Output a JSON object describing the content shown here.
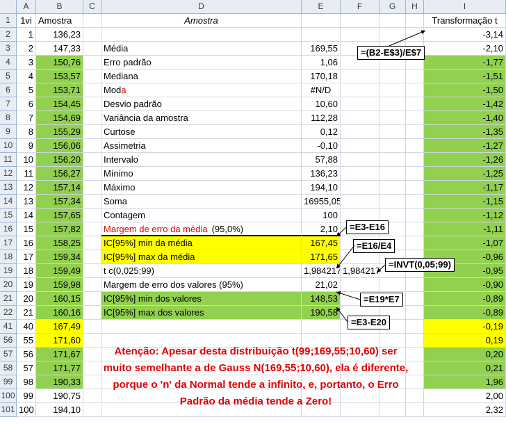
{
  "columns": [
    "A",
    "B",
    "C",
    "D",
    "E",
    "F",
    "G",
    "H",
    "I"
  ],
  "rows": [
    {
      "r": "1",
      "a": "1vi",
      "b": "Amostra",
      "d": "Amostra",
      "e": "",
      "f": "",
      "i": "Transformação t",
      "bFill": "",
      "iFill": ""
    },
    {
      "r": "2",
      "a": "1",
      "b": "136,23",
      "d": "",
      "e": "",
      "f": "",
      "i": "-3,14",
      "bFill": "",
      "iFill": ""
    },
    {
      "r": "3",
      "a": "2",
      "b": "147,33",
      "d": "Média",
      "e": "169,55",
      "f": "",
      "i": "-2,10",
      "bFill": "",
      "iFill": ""
    },
    {
      "r": "4",
      "a": "3",
      "b": "150,76",
      "d": "Erro padrão",
      "e": "1,06",
      "f": "",
      "i": "-1,77",
      "bFill": "green",
      "iFill": "green"
    },
    {
      "r": "5",
      "a": "4",
      "b": "153,57",
      "d": "Mediana",
      "e": "170,18",
      "f": "",
      "i": "-1,51",
      "bFill": "green",
      "iFill": "green"
    },
    {
      "r": "6",
      "a": "5",
      "b": "153,71",
      "d": "Moda",
      "e": "#N/D",
      "f": "",
      "i": "-1,50",
      "bFill": "green",
      "iFill": "green"
    },
    {
      "r": "7",
      "a": "6",
      "b": "154,45",
      "d": "Desvio padrão",
      "e": "10,60",
      "f": "",
      "i": "-1,42",
      "bFill": "green",
      "iFill": "green"
    },
    {
      "r": "8",
      "a": "7",
      "b": "154,69",
      "d": "Variância da amostra",
      "e": "112,28",
      "f": "",
      "i": "-1,40",
      "bFill": "green",
      "iFill": "green"
    },
    {
      "r": "9",
      "a": "8",
      "b": "155,29",
      "d": "Curtose",
      "e": "0,12",
      "f": "",
      "i": "-1,35",
      "bFill": "green",
      "iFill": "green"
    },
    {
      "r": "10",
      "a": "9",
      "b": "156,06",
      "d": "Assimetria",
      "e": "-0,10",
      "f": "",
      "i": "-1,27",
      "bFill": "green",
      "iFill": "green"
    },
    {
      "r": "11",
      "a": "10",
      "b": "156,20",
      "d": "Intervalo",
      "e": "57,88",
      "f": "",
      "i": "-1,26",
      "bFill": "green",
      "iFill": "green"
    },
    {
      "r": "12",
      "a": "11",
      "b": "156,27",
      "d": "Mínimo",
      "e": "136,23",
      "f": "",
      "i": "-1,25",
      "bFill": "green",
      "iFill": "green"
    },
    {
      "r": "13",
      "a": "12",
      "b": "157,14",
      "d": "Máximo",
      "e": "194,10",
      "f": "",
      "i": "-1,17",
      "bFill": "green",
      "iFill": "green"
    },
    {
      "r": "14",
      "a": "13",
      "b": "157,34",
      "d": "Soma",
      "e": "16955,05",
      "f": "",
      "i": "-1,15",
      "bFill": "green",
      "iFill": "green"
    },
    {
      "r": "15",
      "a": "14",
      "b": "157,65",
      "d": "Contagem",
      "e": "100",
      "f": "",
      "i": "-1,12",
      "bFill": "green",
      "iFill": "green"
    },
    {
      "r": "16",
      "a": "15",
      "b": "157,82",
      "d": "Margem de erro da média",
      "d2": "(95,0%)",
      "e": "2,10",
      "f": "",
      "i": "-1,11",
      "bFill": "green",
      "iFill": "green"
    },
    {
      "r": "17",
      "a": "16",
      "b": "158,25",
      "d": "IC[95%] min da média",
      "e": "167,45",
      "f": "",
      "i": "-1,07",
      "bFill": "green",
      "iFill": "green",
      "deFill": "yellow"
    },
    {
      "r": "18",
      "a": "17",
      "b": "159,34",
      "d": "IC[95%] max da média",
      "e": "171,65",
      "f": "",
      "i": "-0,96",
      "bFill": "green",
      "iFill": "green",
      "deFill": "yellow"
    },
    {
      "r": "19",
      "a": "18",
      "b": "159,49",
      "d": "t c(0,025;99)",
      "e": "1,984217",
      "f": "1,984217",
      "i": "-0,95",
      "bFill": "green",
      "iFill": "green"
    },
    {
      "r": "20",
      "a": "19",
      "b": "159,98",
      "d": "Margem de erro dos valores (95%)",
      "e": "21,02",
      "f": "",
      "i": "-0,90",
      "bFill": "green",
      "iFill": "green"
    },
    {
      "r": "21",
      "a": "20",
      "b": "160,15",
      "d": "IC[95%] min dos valores",
      "e": "148,53",
      "f": "",
      "i": "-0,89",
      "bFill": "green",
      "iFill": "green",
      "deFill": "green"
    },
    {
      "r": "22",
      "a": "21",
      "b": "160,16",
      "d": "IC[95%] max dos valores",
      "e": "190,58",
      "f": "",
      "i": "-0,89",
      "bFill": "green",
      "iFill": "green",
      "deFill": "green"
    },
    {
      "r": "41",
      "a": "40",
      "b": "167,49",
      "d": "",
      "e": "",
      "f": "",
      "i": "-0,19",
      "bFill": "yellow",
      "iFill": "yellow"
    },
    {
      "r": "56",
      "a": "55",
      "b": "171,60",
      "d": "",
      "e": "",
      "f": "",
      "i": "0,19",
      "bFill": "yellow",
      "iFill": "yellow"
    },
    {
      "r": "57",
      "a": "56",
      "b": "171,67",
      "d": "",
      "e": "",
      "f": "",
      "i": "0,20",
      "bFill": "green",
      "iFill": "green"
    },
    {
      "r": "58",
      "a": "57",
      "b": "171,77",
      "d": "",
      "e": "",
      "f": "",
      "i": "0,21",
      "bFill": "green",
      "iFill": "green"
    },
    {
      "r": "99",
      "a": "98",
      "b": "190,33",
      "d": "",
      "e": "",
      "f": "",
      "i": "1,96",
      "bFill": "green",
      "iFill": "green"
    },
    {
      "r": "100",
      "a": "99",
      "b": "190,75",
      "d": "",
      "e": "",
      "f": "",
      "i": "2,00",
      "bFill": "",
      "": "",
      "iFill": ""
    },
    {
      "r": "101",
      "a": "100",
      "b": "194,10",
      "d": "",
      "e": "",
      "f": "",
      "i": "2,32",
      "bFill": "",
      "iFill": ""
    }
  ],
  "callouts": {
    "transform": "=(B2-E$3)/E$7",
    "margin": "=E3-E16",
    "ic_max": "=E16/E4",
    "invt": "=INVT(0,05;99)",
    "margin_values": "=E19*E7",
    "ic_min_values": "=E3-E20"
  },
  "note": "Atenção: Apesar desta distribuição t(99;169,55;10,60) ser muito semelhante a de Gauss N(169,55;10,60), ela é diferente, porque o 'n' da Normal tende a infinito, e, portanto, o Erro Padrão da média tende a Zero!",
  "colors": {
    "green": "#92d050",
    "yellow": "#ffff00",
    "red": "#e00000",
    "header": "#e8edf5"
  }
}
